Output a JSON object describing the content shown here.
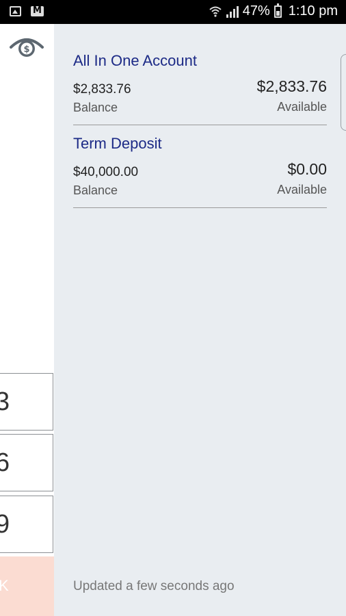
{
  "status_bar": {
    "battery": "47%",
    "time": "1:10 pm",
    "icons": [
      "image-icon",
      "gmail-icon",
      "wifi-icon",
      "signal-icon",
      "battery-icon"
    ]
  },
  "drawer": {
    "logo_icon": "eye-dollar-icon",
    "keys": [
      "3",
      "6",
      "9"
    ],
    "ok_label": "K"
  },
  "accounts": [
    {
      "name": "All In One Account",
      "balance": "$2,833.76",
      "balance_label": "Balance",
      "available": "$2,833.76",
      "available_label": "Available"
    },
    {
      "name": "Term Deposit",
      "balance": "$40,000.00",
      "balance_label": "Balance",
      "available": "$0.00",
      "available_label": "Available"
    }
  ],
  "footer": {
    "updated_text": "Updated a few seconds ago"
  },
  "colors": {
    "accent": "#1c2a86",
    "background": "#e9edf1",
    "ok_key": "#fbdcd2"
  }
}
